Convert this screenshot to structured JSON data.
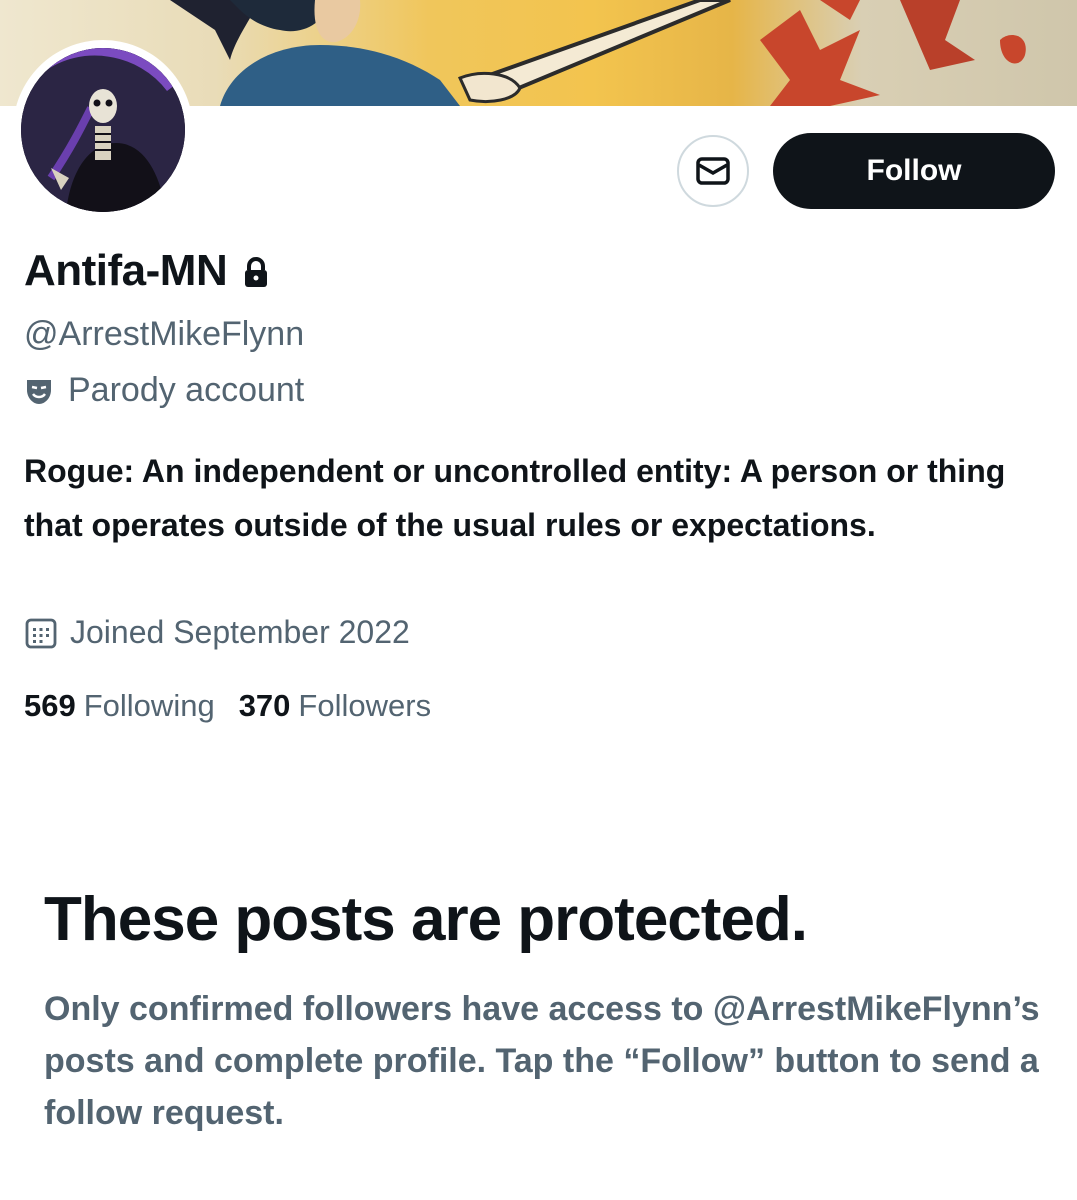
{
  "profile": {
    "name": "Antifa-MN",
    "handle": "@ArrestMikeFlynn",
    "parody_label": "Parody account",
    "bio": "Rogue: An independent or uncontrolled entity: A person or thing that operates outside of the usual rules or expectations.",
    "joined": "Joined September 2022",
    "following_count": "569",
    "following_label": "Following",
    "followers_count": "370",
    "followers_label": "Followers"
  },
  "actions": {
    "follow_label": "Follow",
    "message_icon": "envelope-icon"
  },
  "protected": {
    "title": "These posts are protected.",
    "description": "Only confirmed followers have access to @ArrestMikeFlynn’s posts and complete profile. Tap the “Follow” button to send a follow request."
  },
  "colors": {
    "text_primary": "#0f1419",
    "text_secondary": "#536471",
    "button_dark": "#0f1419",
    "border": "#cfd9de"
  }
}
